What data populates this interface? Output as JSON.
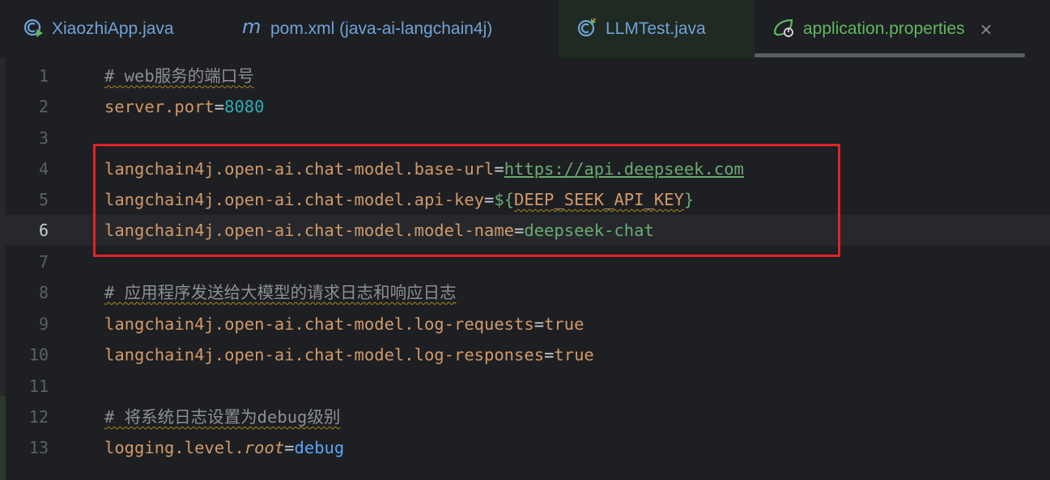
{
  "tabs": [
    {
      "label": "XiaozhiApp.java",
      "icon": "java-run-class-icon",
      "active": false
    },
    {
      "label": "pom.xml (java-ai-langchain4j)",
      "icon": "maven-m-icon",
      "active": false
    },
    {
      "label": "LLMTest.java",
      "icon": "java-test-class-icon",
      "active": false
    },
    {
      "label": "application.properties",
      "icon": "spring-leaf-icon",
      "active": true
    }
  ],
  "close_glyph": "×",
  "editor": {
    "current_line": 6,
    "lines": [
      {
        "n": "1",
        "comment": "# web服务的端口号"
      },
      {
        "n": "2",
        "key": "server.port",
        "eq": "=",
        "value": "8080"
      },
      {
        "n": "3"
      },
      {
        "n": "4",
        "key": "langchain4j.open-ai.chat-model.base-url",
        "eq": "=",
        "value": "https://api.deepseek.com"
      },
      {
        "n": "5",
        "key": "langchain4j.open-ai.chat-model.api-key",
        "eq": "=",
        "value_prefix": "${",
        "value": "DEEP_SEEK_API_KEY",
        "value_suffix": "}"
      },
      {
        "n": "6",
        "key": "langchain4j.open-ai.chat-model.model-name",
        "eq": "=",
        "value": "deepseek-chat"
      },
      {
        "n": "7"
      },
      {
        "n": "8",
        "comment": "# 应用程序发送给大模型的请求日志和响应日志"
      },
      {
        "n": "9",
        "key": "langchain4j.open-ai.chat-model.log-requests",
        "eq": "=",
        "value": "true"
      },
      {
        "n": "10",
        "key": "langchain4j.open-ai.chat-model.log-responses",
        "eq": "=",
        "value": "true"
      },
      {
        "n": "11"
      },
      {
        "n": "12",
        "comment": "# 将系统日志设置为debug级别"
      },
      {
        "n": "13",
        "key_prefix": "logging.level.",
        "key_italic": "root",
        "eq": "=",
        "value": "debug"
      }
    ]
  },
  "colors": {
    "highlight_box": "#e0232b",
    "key": "#d09a6a",
    "value": "#6aab73",
    "number": "#2aacb8",
    "comment": "#8c8f94"
  }
}
